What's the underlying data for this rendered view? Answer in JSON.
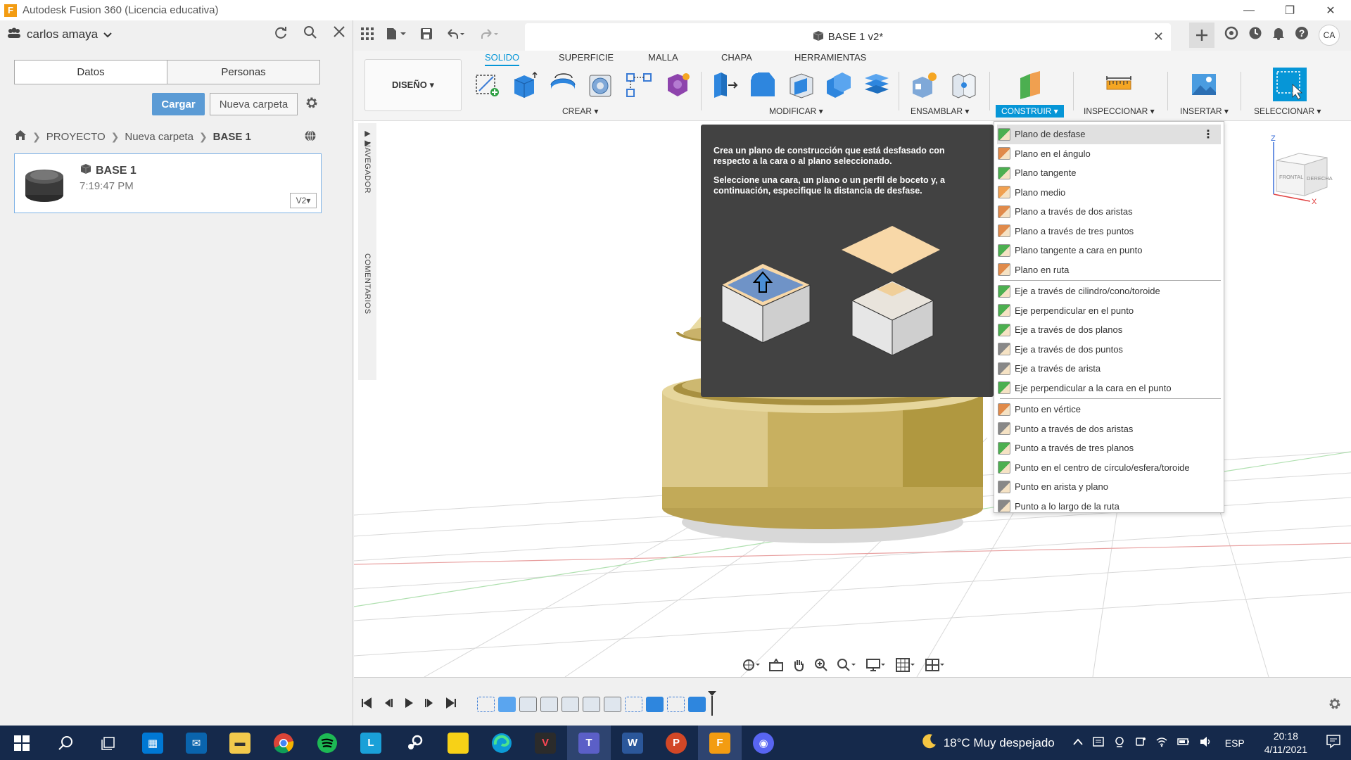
{
  "window": {
    "app_logo": "F",
    "title": "Autodesk Fusion 360 (Licencia educativa)",
    "minimize": "—",
    "restore": "❐",
    "close": "✕"
  },
  "data_panel": {
    "user": "carlos amaya",
    "tabs": [
      "Datos",
      "Personas"
    ],
    "upload_button": "Cargar",
    "new_folder_button": "Nueva carpeta",
    "breadcrumb": [
      "PROYECTO",
      "Nueva carpeta",
      "BASE 1"
    ],
    "file": {
      "name": "BASE 1",
      "time": "7:19:47 PM",
      "version": "V2▾"
    }
  },
  "document": {
    "tab_title": "BASE 1 v2*",
    "close": "✕",
    "user_initials": "CA"
  },
  "ribbon": {
    "workspace": "DISEÑO ▾",
    "tabs": [
      "SOLIDO",
      "SUPERFICIE",
      "MALLA",
      "CHAPA",
      "HERRAMIENTAS"
    ],
    "active_tab": "SOLIDO",
    "groups": [
      "CREAR ▾",
      "MODIFICAR ▾",
      "ENSAMBLAR ▾",
      "CONSTRUIR ▾",
      "INSPECCIONAR ▾",
      "INSERTAR ▾",
      "SELECCIONAR ▾"
    ],
    "active_group": "CONSTRUIR",
    "accent_color": "#0696d7"
  },
  "side_panels": {
    "navigator": "NAVEGADOR",
    "comments": "COMENTARIOS"
  },
  "tooltip": {
    "line1": "Crea un plano de construcción que está desfasado con respecto a la cara o al plano seleccionado.",
    "line2": "Seleccione una cara, un plano o un perfil de boceto y, a continuación, especifique la distancia de desfase."
  },
  "construct_menu": {
    "planes": [
      "Plano de desfase",
      "Plano en el ángulo",
      "Plano tangente",
      "Plano medio",
      "Plano a través de dos aristas",
      "Plano a través de tres puntos",
      "Plano tangente a cara en punto",
      "Plano en ruta"
    ],
    "axes": [
      "Eje a través de cilindro/cono/toroide",
      "Eje perpendicular en el punto",
      "Eje a través de dos planos",
      "Eje a través de dos puntos",
      "Eje a través de arista",
      "Eje perpendicular a la cara en el punto"
    ],
    "points": [
      "Punto en vértice",
      "Punto a través de dos aristas",
      "Punto a través de tres planos",
      "Punto en el centro de círculo/esfera/toroide",
      "Punto en arista y plano",
      "Punto a lo largo de la ruta"
    ],
    "more_icon": "⋮"
  },
  "viewcube": {
    "front": "FRONTAL",
    "right": "DERECHA",
    "axis_z": "Z",
    "axis_x": "X"
  },
  "taskbar": {
    "weather": "18°C  Muy despejado",
    "language": "ESP",
    "time": "20:18",
    "date": "4/11/2021",
    "apps": [
      "start",
      "search",
      "task-view",
      "store",
      "mail",
      "explorer",
      "chrome",
      "spotify",
      "launcher",
      "steam",
      "sticky-notes",
      "edge",
      "valorant",
      "teams",
      "word",
      "powerpoint",
      "fusion360",
      "discord"
    ]
  }
}
